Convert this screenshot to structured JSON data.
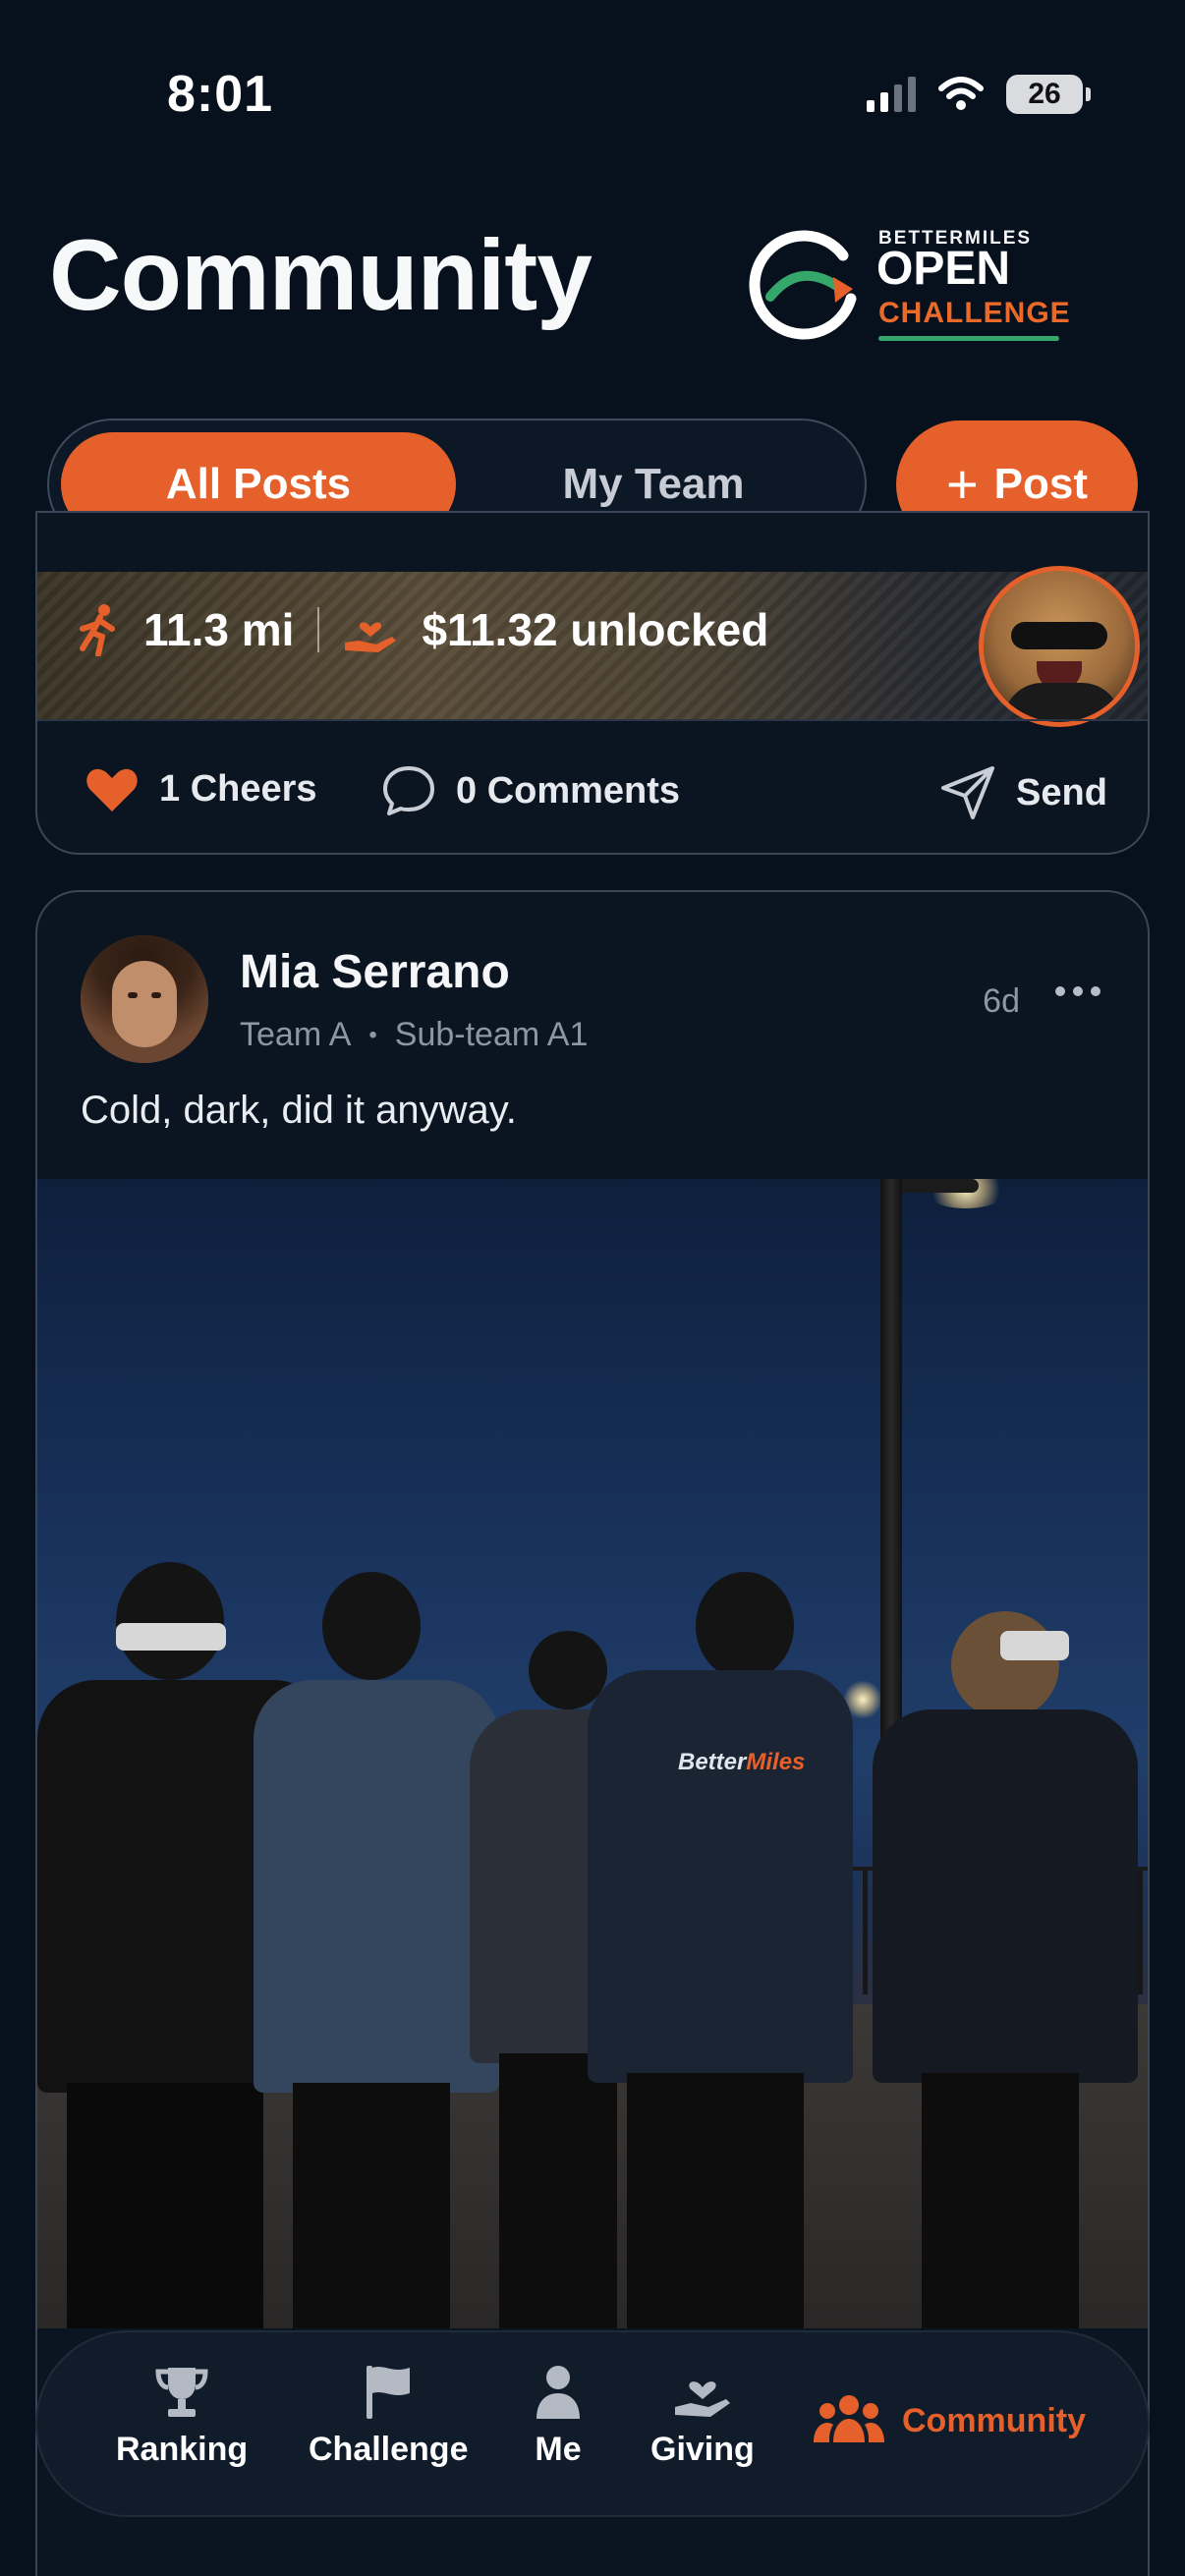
{
  "status_bar": {
    "time": "8:01",
    "battery": "26"
  },
  "header": {
    "title": "Community"
  },
  "logo": {
    "brand": "BETTERMILES",
    "line1": "OPEN",
    "line2": "CHALLENGE"
  },
  "tabs": [
    {
      "label": "All Posts",
      "active": true
    },
    {
      "label": "My Team",
      "active": false
    }
  ],
  "post_button": {
    "label": "Post"
  },
  "previous_post": {
    "distance": "11.3 mi",
    "unlocked": "$11.32 unlocked",
    "cheers": "1 Cheers",
    "comments": "0 Comments",
    "send": "Send"
  },
  "post": {
    "author": "Mia Serrano",
    "team": "Team A",
    "subteam": "Sub-team A1",
    "age": "6d",
    "caption": "Cold, dark, did it anyway.",
    "photo_shirt_logo_a": "Better",
    "photo_shirt_logo_b": "Miles"
  },
  "bottom_nav": [
    {
      "label": "Ranking",
      "icon": "trophy-icon"
    },
    {
      "label": "Challenge",
      "icon": "flag-icon"
    },
    {
      "label": "Me",
      "icon": "person-icon"
    },
    {
      "label": "Giving",
      "icon": "giving-hand-icon"
    },
    {
      "label": "Community",
      "icon": "people-icon",
      "active": true
    }
  ],
  "colors": {
    "accent": "#e5602a",
    "background": "#07111d",
    "card": "#0b1522",
    "logo_green": "#36a76a"
  }
}
